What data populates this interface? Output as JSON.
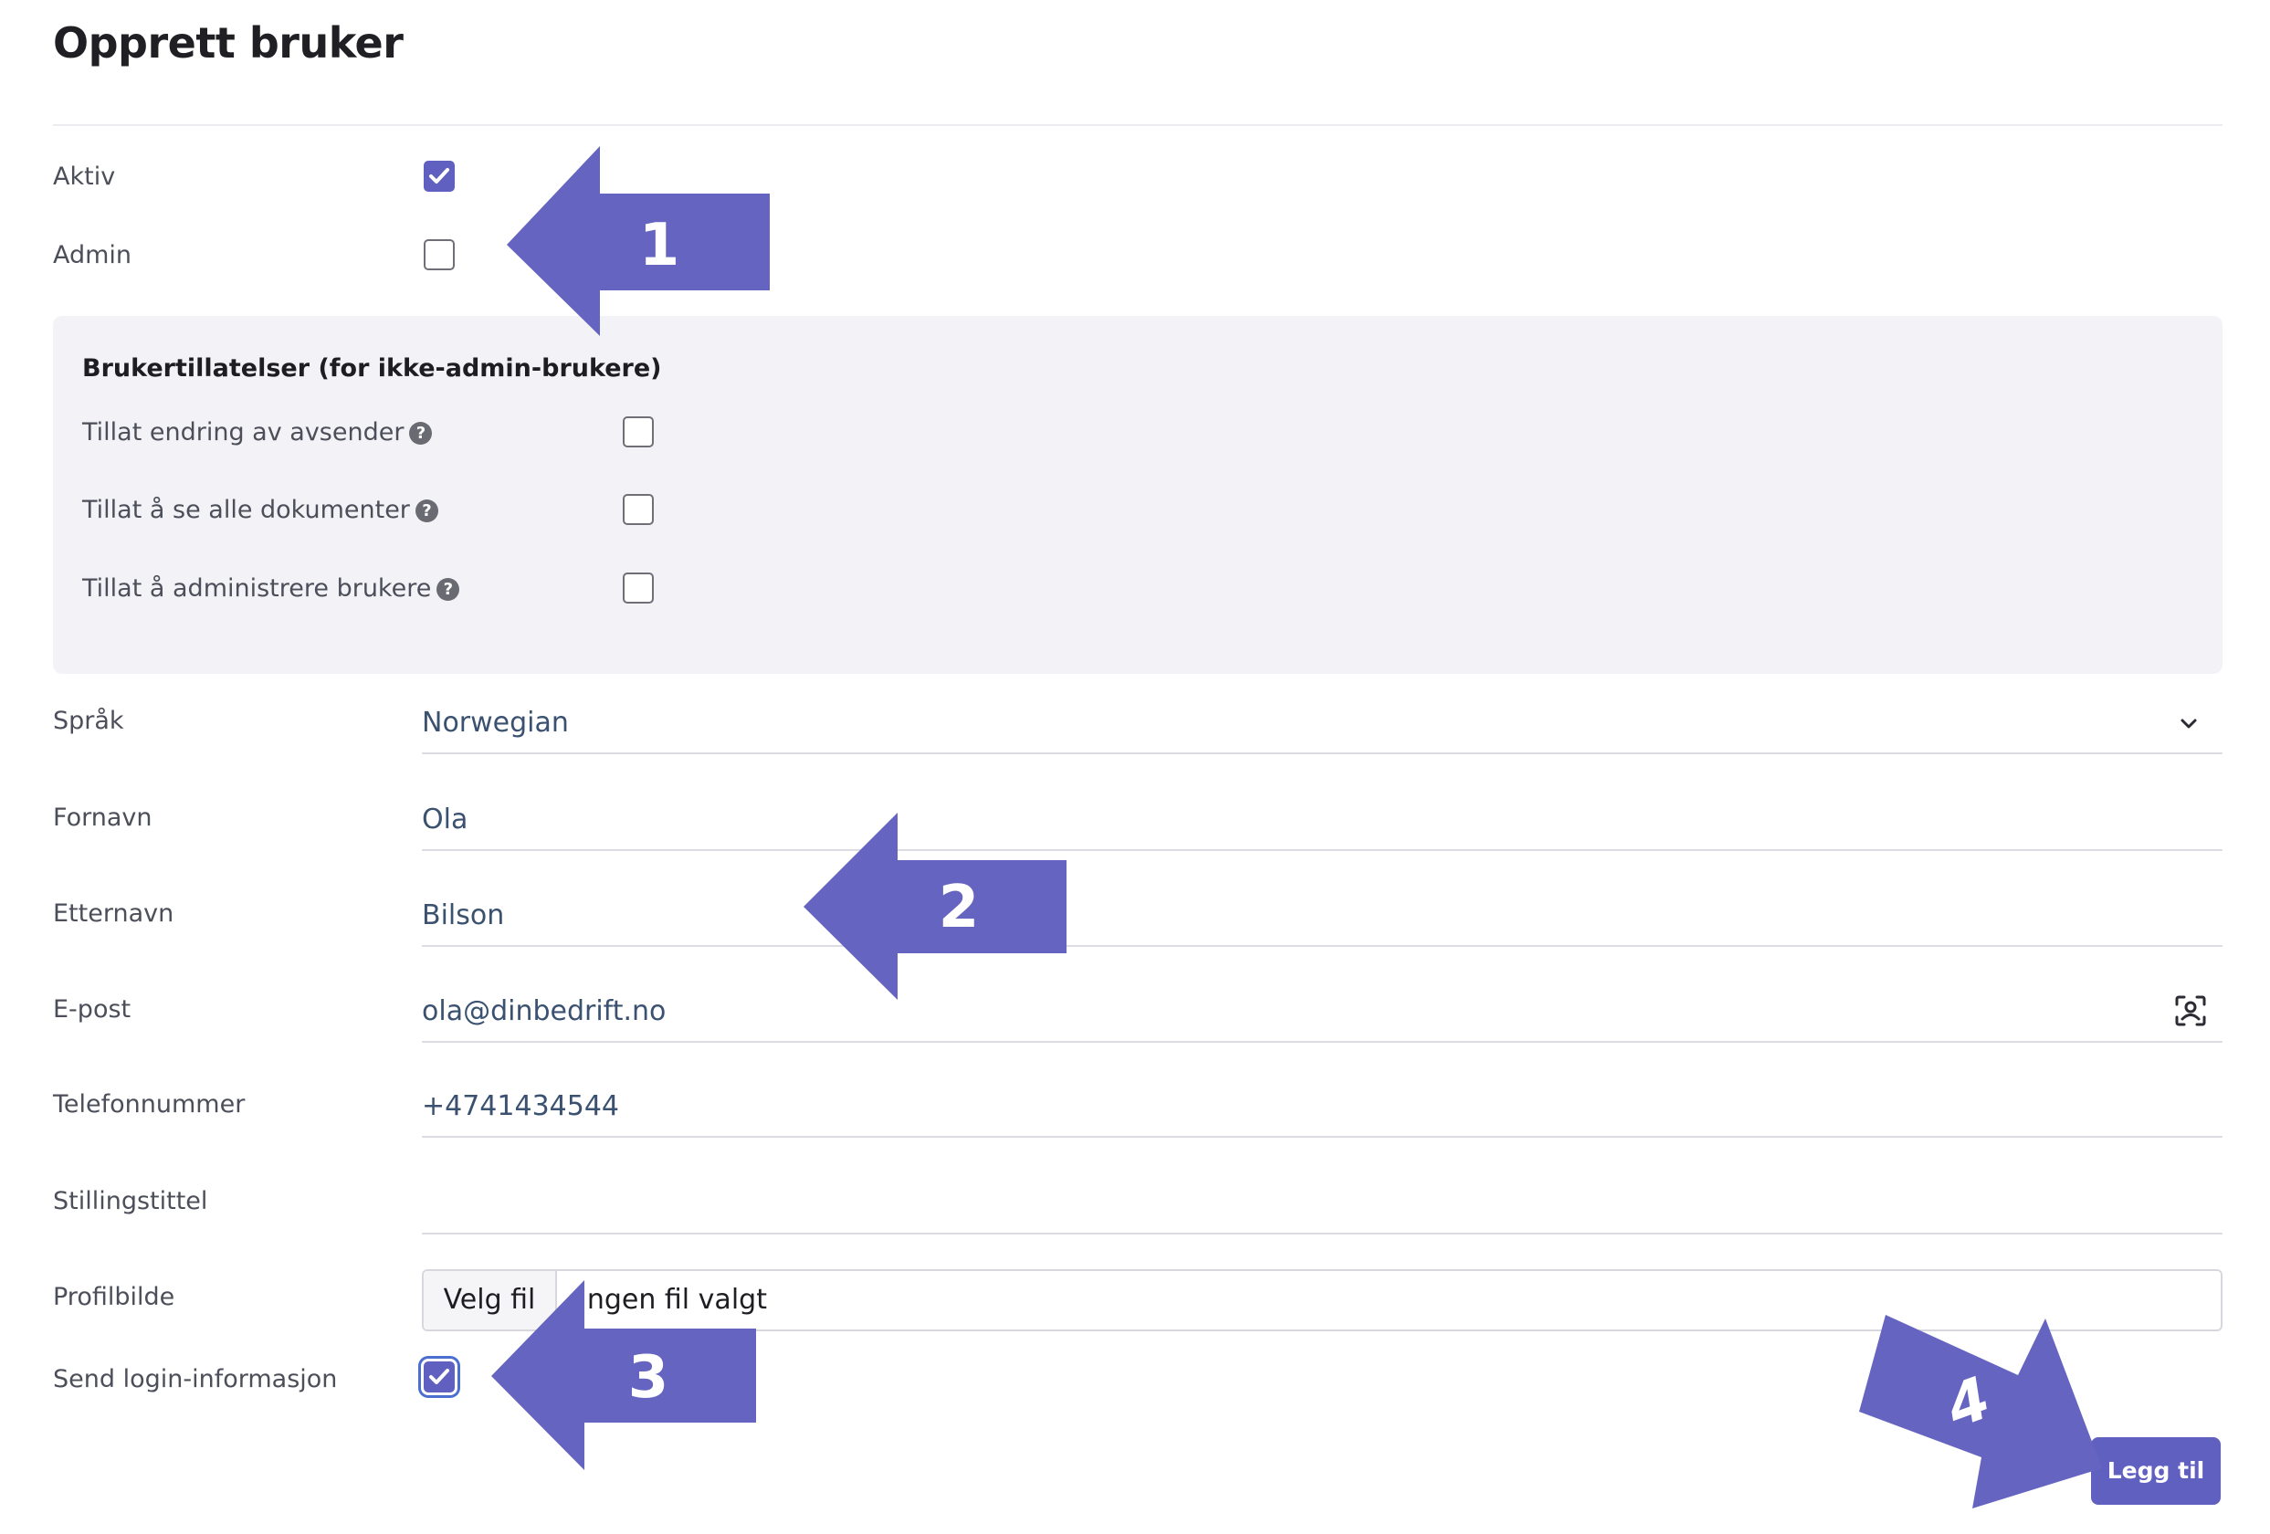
{
  "page": {
    "title": "Opprett bruker"
  },
  "flags": {
    "active": {
      "label": "Aktiv",
      "checked": true
    },
    "admin": {
      "label": "Admin",
      "checked": false
    }
  },
  "permissions": {
    "heading": "Brukertillatelser (for ikke-admin-brukere)",
    "help_glyph": "?",
    "items": [
      {
        "label": "Tillat endring av avsender",
        "checked": false
      },
      {
        "label": "Tillat å se alle dokumenter",
        "checked": false
      },
      {
        "label": "Tillat å administrere brukere",
        "checked": false
      }
    ]
  },
  "form": {
    "language": {
      "label": "Språk",
      "value": "Norwegian"
    },
    "first_name": {
      "label": "Fornavn",
      "value": "Ola"
    },
    "last_name": {
      "label": "Etternavn",
      "value": "Bilson"
    },
    "email": {
      "label": "E-post",
      "value": "ola@dinbedrift.no"
    },
    "phone": {
      "label": "Telefonnummer",
      "value": "+4741434544"
    },
    "job_title": {
      "label": "Stillingstittel",
      "value": ""
    },
    "profile_picture": {
      "label": "Profilbilde",
      "button": "Velg fil",
      "status": "Ingen fil valgt"
    },
    "send_login": {
      "label": "Send login-informasjon",
      "checked": true
    }
  },
  "actions": {
    "submit_label": "Legg til"
  },
  "annotations": {
    "color": "#6565c1",
    "callouts": [
      "1",
      "2",
      "3",
      "4"
    ]
  },
  "icons": {
    "dropdown": "chevron-down-icon",
    "email_field": "contact-scan-icon",
    "checkmark": "check-icon",
    "help": "help-circle-icon"
  }
}
